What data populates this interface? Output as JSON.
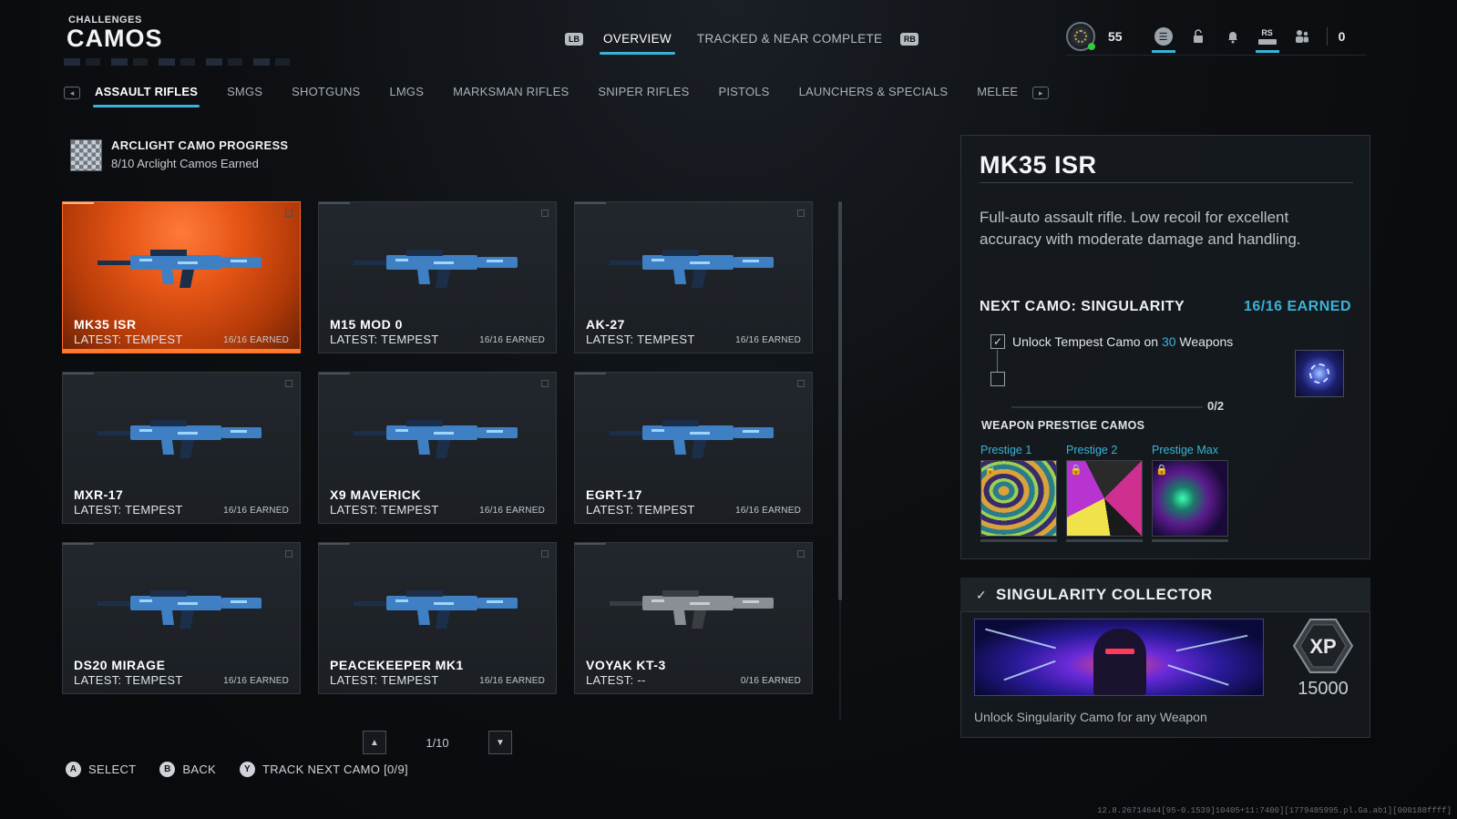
{
  "header": {
    "subtitle": "CHALLENGES",
    "title": "CAMOS"
  },
  "top_tabs": {
    "left_bumper": "LB",
    "right_bumper": "RB",
    "items": [
      {
        "label": "OVERVIEW",
        "active": true
      },
      {
        "label": "TRACKED & NEAR COMPLETE",
        "active": false
      }
    ]
  },
  "status": {
    "level": "55",
    "rs_label": "RS",
    "count": "0"
  },
  "categories": {
    "items": [
      {
        "label": "ASSAULT RIFLES",
        "active": true
      },
      {
        "label": "SMGS"
      },
      {
        "label": "SHOTGUNS"
      },
      {
        "label": "LMGS"
      },
      {
        "label": "MARKSMAN RIFLES"
      },
      {
        "label": "SNIPER RIFLES"
      },
      {
        "label": "PISTOLS"
      },
      {
        "label": "LAUNCHERS & SPECIALS"
      },
      {
        "label": "MELEE"
      }
    ]
  },
  "arclight": {
    "title": "ARCLIGHT CAMO PROGRESS",
    "subtitle": "8/10 Arclight Camos Earned"
  },
  "weapons": [
    {
      "name": "MK35 ISR",
      "latest": "LATEST: TEMPEST",
      "earned": "16/16 EARNED",
      "selected": true,
      "camo": "blue"
    },
    {
      "name": "M15 MOD 0",
      "latest": "LATEST: TEMPEST",
      "earned": "16/16 EARNED",
      "camo": "blue"
    },
    {
      "name": "AK-27",
      "latest": "LATEST: TEMPEST",
      "earned": "16/16 EARNED",
      "camo": "blue"
    },
    {
      "name": "MXR-17",
      "latest": "LATEST: TEMPEST",
      "earned": "16/16 EARNED",
      "camo": "blue"
    },
    {
      "name": "X9 MAVERICK",
      "latest": "LATEST: TEMPEST",
      "earned": "16/16 EARNED",
      "camo": "blue"
    },
    {
      "name": "EGRT-17",
      "latest": "LATEST: TEMPEST",
      "earned": "16/16 EARNED",
      "camo": "blue"
    },
    {
      "name": "DS20 MIRAGE",
      "latest": "LATEST: TEMPEST",
      "earned": "16/16 EARNED",
      "camo": "blue"
    },
    {
      "name": "PEACEKEEPER MK1",
      "latest": "LATEST: TEMPEST",
      "earned": "16/16 EARNED",
      "camo": "blue"
    },
    {
      "name": "VOYAK KT-3",
      "latest": "LATEST: --",
      "earned": "0/16 EARNED",
      "camo": "grey"
    }
  ],
  "pagination": {
    "label": "1/10"
  },
  "hints": [
    {
      "glyph": "A",
      "label": "SELECT"
    },
    {
      "glyph": "B",
      "label": "BACK"
    },
    {
      "glyph": "Y",
      "label": "TRACK NEXT CAMO [0/9]"
    }
  ],
  "build_string": "12.8.26714644[95-0.1539]10405+11:7400][1779485995.pl.Ga.ab1][000188ffff]",
  "detail": {
    "title": "MK35 ISR",
    "description": "Full-auto assault rifle. Low recoil for excellent accuracy with moderate damage and handling.",
    "next_camo_label": "NEXT CAMO: SINGULARITY",
    "earned_label": "16/16 EARNED",
    "requirement_pre": "Unlock Tempest Camo on ",
    "requirement_num": "30",
    "requirement_post": " Weapons",
    "progress": "0/2",
    "prestige_title": "WEAPON PRESTIGE CAMOS",
    "prestige": [
      {
        "label": "Prestige 1"
      },
      {
        "label": "Prestige 2"
      },
      {
        "label": "Prestige Max"
      }
    ]
  },
  "collector": {
    "title": "SINGULARITY COLLECTOR",
    "xp_label": "XP",
    "xp_value": "15000",
    "description": "Unlock Singularity Camo for any Weapon"
  },
  "colors": {
    "accent": "#3ab3d8",
    "selected_card": "#e55515"
  }
}
